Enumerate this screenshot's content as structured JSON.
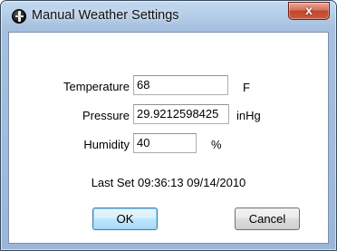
{
  "window": {
    "title": "Manual Weather Settings",
    "close_glyph": "x",
    "icon": "app-icon"
  },
  "fields": {
    "temperature": {
      "label": "Temperature",
      "value": "68",
      "unit": "F"
    },
    "pressure": {
      "label": "Pressure",
      "value": "29.9212598425",
      "unit": "inHg"
    },
    "humidity": {
      "label": "Humidity",
      "value": "40",
      "unit": "%"
    }
  },
  "status": {
    "last_set": "Last Set 09:36:13 09/14/2010"
  },
  "buttons": {
    "ok": "OK",
    "cancel": "Cancel"
  }
}
